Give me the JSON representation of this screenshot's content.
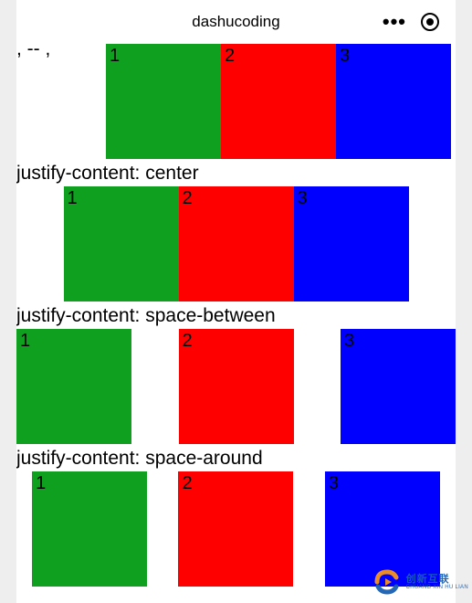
{
  "header": {
    "title": "dashucoding"
  },
  "sections": [
    {
      "label_partial": ", -- ,",
      "boxes": [
        "1",
        "2",
        "3"
      ]
    },
    {
      "label": "justify-content: center",
      "boxes": [
        "1",
        "2",
        "3"
      ]
    },
    {
      "label": "justify-content: space-between",
      "boxes": [
        "1",
        "2",
        "3"
      ]
    },
    {
      "label": "justify-content: space-around",
      "boxes": [
        "1",
        "2",
        "3"
      ]
    }
  ],
  "watermark": {
    "cn": "创新互联",
    "en": "CHUANG XIN HU LIAN"
  }
}
